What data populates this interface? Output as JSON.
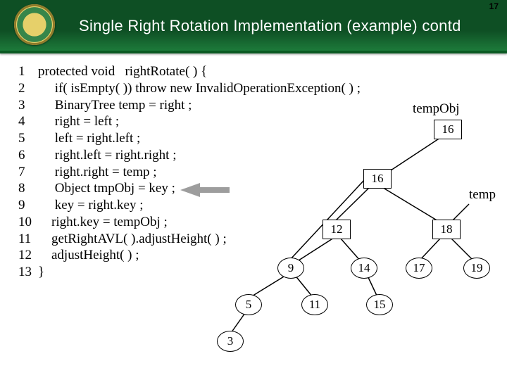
{
  "header": {
    "title": "Single Right Rotation Implementation (example) contd",
    "page_number": "17"
  },
  "code": {
    "lines": [
      {
        "n": "1",
        "t": "protected void   rightRotate( ) {"
      },
      {
        "n": "2",
        "t": "     if( isEmpty( )) throw new InvalidOperationException( ) ;"
      },
      {
        "n": "3",
        "t": "     BinaryTree temp = right ;"
      },
      {
        "n": "4",
        "t": "     right = left ;"
      },
      {
        "n": "5",
        "t": "     left = right.left ;"
      },
      {
        "n": "6",
        "t": "     right.left = right.right ;"
      },
      {
        "n": "7",
        "t": "     right.right = temp ;"
      },
      {
        "n": "8",
        "t": "     Object tmpObj = key ;"
      },
      {
        "n": "9",
        "t": "     key = right.key ;"
      },
      {
        "n": "10",
        "t": "    right.key = tempObj ;"
      },
      {
        "n": "11",
        "t": "    getRightAVL( ).adjustHeight( ) ;"
      },
      {
        "n": "12",
        "t": "    adjustHeight( ) ;"
      },
      {
        "n": "13",
        "t": "}"
      }
    ]
  },
  "labels": {
    "tempObj": "tempObj",
    "temp": "temp"
  },
  "tree": {
    "nodes": {
      "loose16": "16",
      "root": "16",
      "n12": "12",
      "n18": "18",
      "n9": "9",
      "n14": "14",
      "n17": "17",
      "n19": "19",
      "n5": "5",
      "n11": "11",
      "n15": "15",
      "n3": "3"
    }
  }
}
